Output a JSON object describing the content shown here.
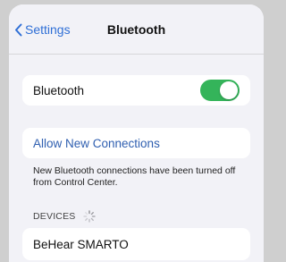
{
  "nav": {
    "back_label": "Settings",
    "title": "Bluetooth"
  },
  "bluetooth_row": {
    "label": "Bluetooth",
    "enabled": true
  },
  "allow_row": {
    "label": "Allow New Connections"
  },
  "footnote": "New Bluetooth connections have been turned off from Control Center.",
  "devices_section": {
    "header": "DEVICES"
  },
  "devices": [
    {
      "name": "BeHear SMARTO"
    }
  ],
  "colors": {
    "accent": "#2f6fd6",
    "toggle_on": "#34b45a",
    "background": "#f2f2f7"
  },
  "icons": {
    "back": "chevron-left-icon",
    "loading": "spinner-icon"
  }
}
